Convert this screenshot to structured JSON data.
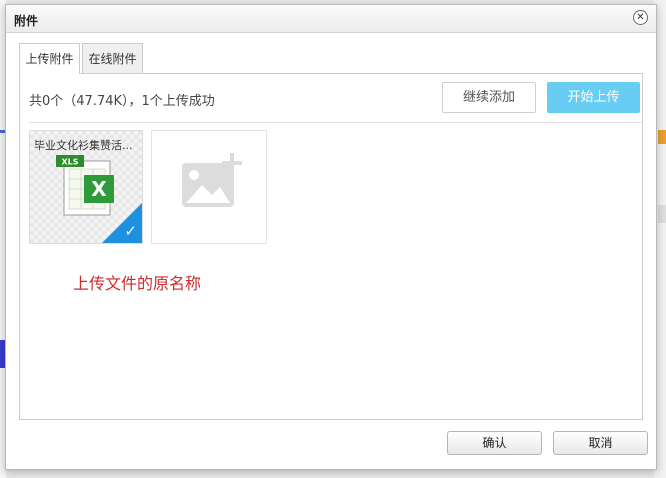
{
  "dialog": {
    "title": "附件",
    "close_icon": "close-icon"
  },
  "tabs": [
    {
      "label": "上传附件",
      "active": true
    },
    {
      "label": "在线附件",
      "active": false
    }
  ],
  "upload": {
    "summary": "共0个（47.74K），1个上传成功",
    "continue_label": "继续添加",
    "start_label": "开始上传",
    "files": [
      {
        "name": "毕业文化衫集赞活...",
        "type": "xls",
        "icon": "xls-file-icon",
        "status": "uploaded"
      }
    ],
    "add_icon": "add-image-icon"
  },
  "annotation": "上传文件的原名称",
  "footer": {
    "ok_label": "确认",
    "cancel_label": "取消"
  },
  "colors": {
    "start_button": "#67cdf2",
    "check_badge": "#1e90e0",
    "annotation": "#d02a2a"
  }
}
